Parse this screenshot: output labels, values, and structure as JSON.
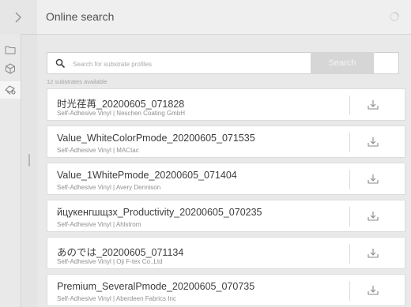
{
  "header": {
    "title": "Online search"
  },
  "search": {
    "placeholder": "Search for substrate profiles",
    "button_label": "Search"
  },
  "count_text": "12 substrates available",
  "substrates": [
    {
      "name": "时光荏苒_20200605_071828",
      "description": "Self-Adhesive Vinyl | Neschen Coating GmbH"
    },
    {
      "name": "Value_WhiteColorPmode_20200605_071535",
      "description": "Self-Adhesive Vinyl | MACtac"
    },
    {
      "name": "Value_1WhitePmode_20200605_071404",
      "description": "Self-Adhesive Vinyl | Avery Dennison"
    },
    {
      "name": "йцукенгшщзх_Productivity_20200605_070235",
      "description": "Self-Adhesive Vinyl | Ahlstrom"
    },
    {
      "name": "あのでは_20200605_071134",
      "description": "Self-Adhesive Vinyl | Oji F-tex Co.,Ltd"
    },
    {
      "name": "Premium_SeveralPmode_20200605_070735",
      "description": "Self-Adhesive Vinyl | Aberdeen Fabrics Inc"
    }
  ],
  "icons": {
    "rail_toggle": "chevron-right-icon",
    "rail_items": [
      "folder-icon",
      "cube-icon",
      "substrate-search-icon"
    ],
    "download": "download-icon",
    "status": "loading-indicator-icon"
  },
  "colors": {
    "background": "#ececec",
    "card": "#ffffff",
    "search_button_disabled": "#d6d6d6"
  }
}
